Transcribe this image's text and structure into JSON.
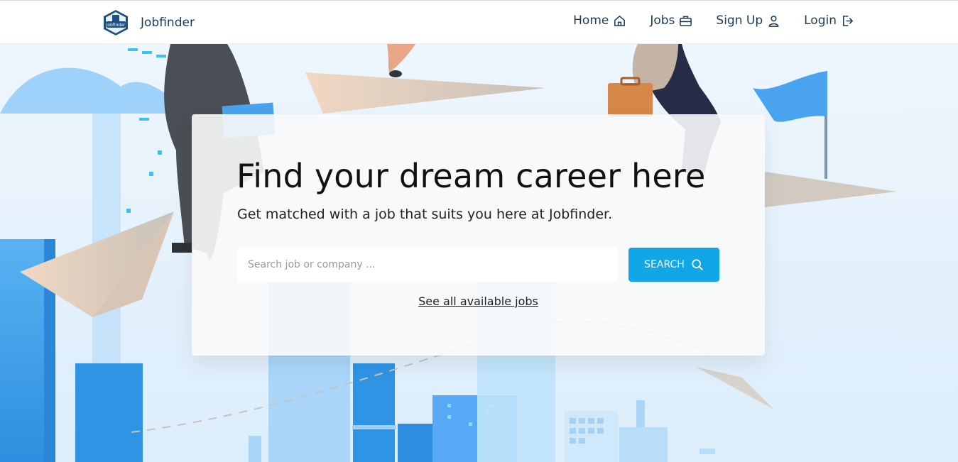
{
  "nav": {
    "brand": "Jobfinder",
    "logo_text": "Jobfinder",
    "links": [
      {
        "label": "Home",
        "icon": "home-icon"
      },
      {
        "label": "Jobs",
        "icon": "briefcase-icon"
      },
      {
        "label": "Sign Up",
        "icon": "user-icon"
      },
      {
        "label": "Login",
        "icon": "login-icon"
      }
    ]
  },
  "hero": {
    "headline": "Find your dream career here",
    "subheadline": "Get matched with a job that suits you here at Jobfinder.",
    "search_placeholder": "Search job or company ...",
    "search_value": "",
    "search_button": "SEARCH",
    "search_icon": "search-icon",
    "see_all_link": "See all available jobs"
  },
  "colors": {
    "accent": "#11a6e5",
    "brand_text": "#1a3a55",
    "sky_blue": "#4aa8f0",
    "paper_plane": "#e9d3c0"
  }
}
